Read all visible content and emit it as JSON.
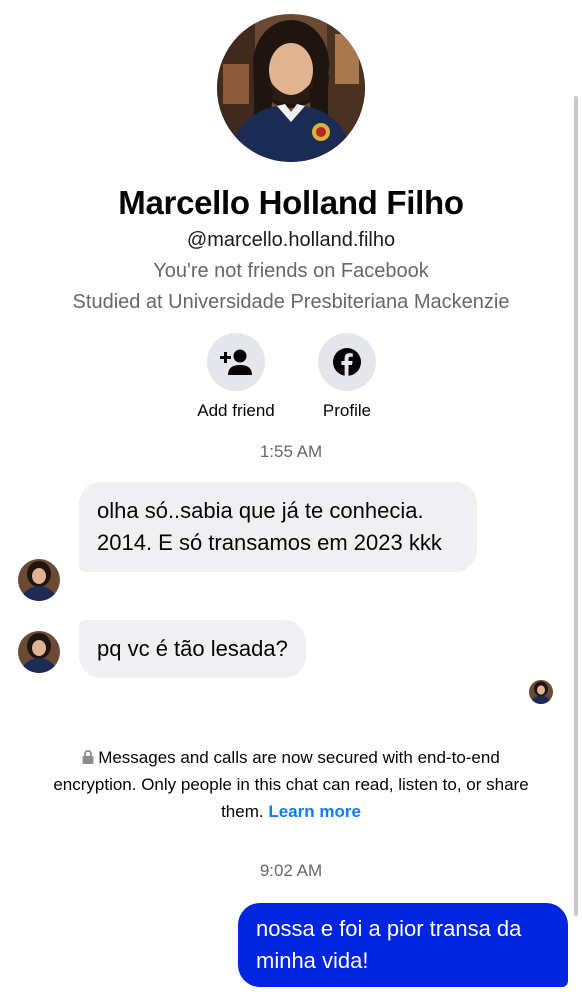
{
  "profile": {
    "name": "Marcello Holland Filho",
    "handle": "@marcello.holland.filho",
    "friends_status": "You're not friends on Facebook",
    "education": "Studied at Universidade Presbiteriana Mackenzie"
  },
  "actions": {
    "add_friend_label": "Add friend",
    "add_friend_icon": "add-person-icon",
    "profile_label": "Profile",
    "profile_icon": "facebook-icon"
  },
  "conversation": {
    "timestamp_1": "1:55 AM",
    "incoming_1": "olha só..sabia que já te conhecia. 2014. E só transamos em 2023 kkk",
    "incoming_2": "pq vc é tão lesada?",
    "encryption_text": "Messages and calls are now secured with end-to-end encryption. Only people in this chat can read, listen to, or share them.",
    "encryption_link": "Learn more",
    "timestamp_2": "9:02 AM",
    "outgoing_1": "nossa e foi a pior transa da minha vida!"
  },
  "colors": {
    "outgoing_bubble": "#0025e0",
    "incoming_bubble": "#f0f0f2",
    "link": "#0a7cff",
    "muted_text": "#65676b"
  }
}
